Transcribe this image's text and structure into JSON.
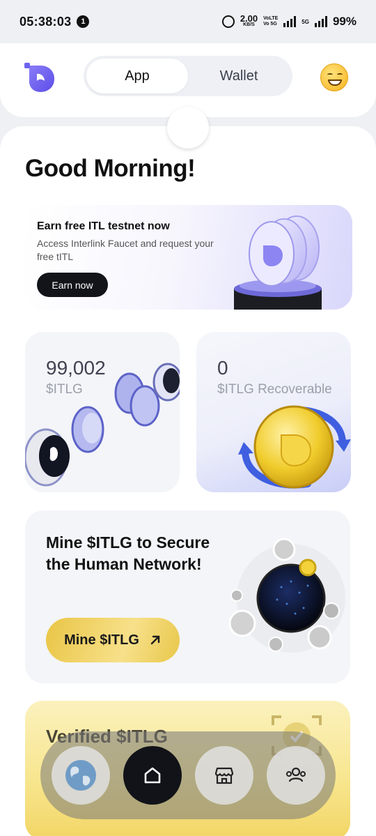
{
  "status_bar": {
    "time": "05:38:03",
    "notification_count": "1",
    "speed_value": "2.00",
    "speed_unit": "KB/S",
    "volte_top": "VoLTE",
    "volte_bottom": "Vo 5G",
    "network": "5G",
    "battery": "99%"
  },
  "header": {
    "tabs": [
      {
        "label": "App",
        "active": true
      },
      {
        "label": "Wallet",
        "active": false
      }
    ]
  },
  "greeting": "Good Morning!",
  "promo": {
    "title": "Earn free ITL testnet now",
    "subtitle": "Access Interlink Faucet and request your free tITL",
    "button": "Earn now"
  },
  "balance_card": {
    "value": "99,002",
    "label": "$ITLG"
  },
  "recoverable_card": {
    "value": "0",
    "label": "$ITLG Recoverable"
  },
  "mine_card": {
    "title": "Mine $ITLG to Secure the Human Network!",
    "button": "Mine $ITLG",
    "button_icon": "arrow-up-right-icon"
  },
  "verified_card": {
    "title": "Verified $ITLG"
  },
  "bottom_nav": {
    "items": [
      {
        "icon": "globe-icon",
        "active": false
      },
      {
        "icon": "home-icon",
        "active": true
      },
      {
        "icon": "store-icon",
        "active": false
      },
      {
        "icon": "users-icon",
        "active": false
      }
    ]
  },
  "colors": {
    "brand_purple": "#6b63f0",
    "gold": "#e9c545",
    "dark": "#12141a"
  }
}
